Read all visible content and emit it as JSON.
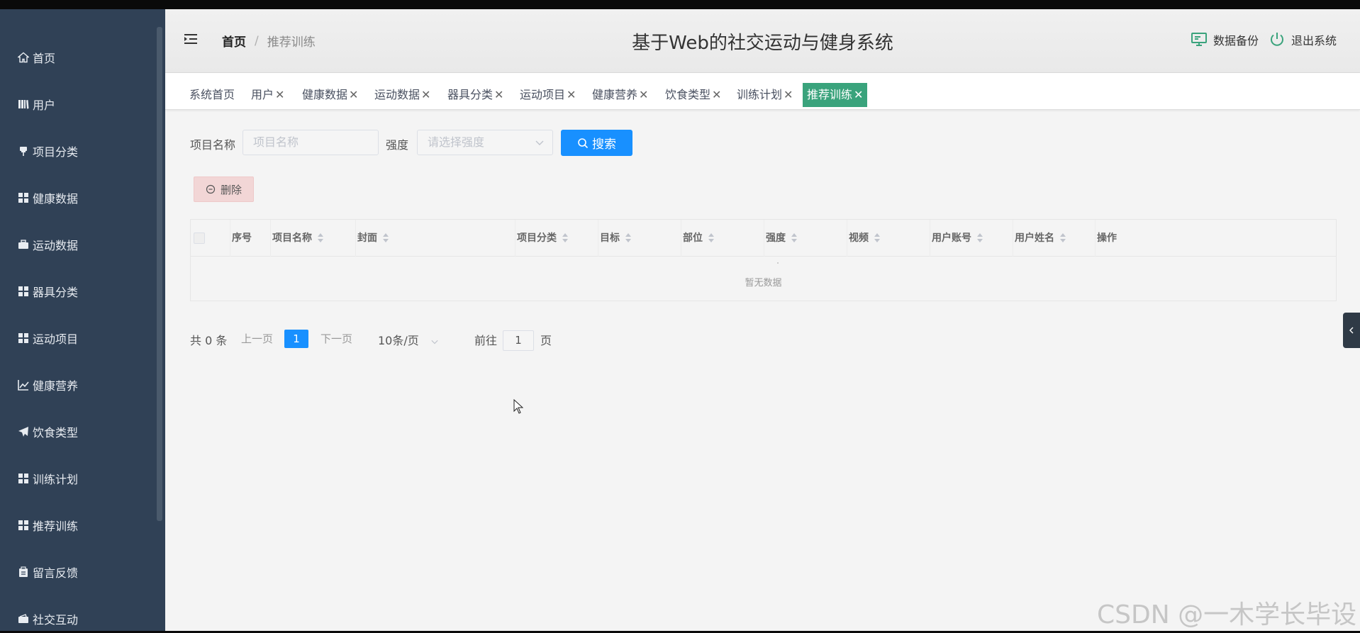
{
  "sidebar": {
    "items": [
      {
        "label": "首页",
        "icon": "home-icon"
      },
      {
        "label": "用户",
        "icon": "library-icon"
      },
      {
        "label": "项目分类",
        "icon": "pin-icon"
      },
      {
        "label": "健康数据",
        "icon": "grid-icon"
      },
      {
        "label": "运动数据",
        "icon": "briefcase-icon"
      },
      {
        "label": "器具分类",
        "icon": "grid-icon"
      },
      {
        "label": "运动项目",
        "icon": "grid-icon"
      },
      {
        "label": "健康营养",
        "icon": "chart-icon"
      },
      {
        "label": "饮食类型",
        "icon": "send-icon"
      },
      {
        "label": "训练计划",
        "icon": "grid-icon"
      },
      {
        "label": "推荐训练",
        "icon": "grid-icon"
      },
      {
        "label": "留言反馈",
        "icon": "clipboard-icon"
      },
      {
        "label": "社交互动",
        "icon": "wallet-icon"
      }
    ]
  },
  "header": {
    "breadcrumb_home": "首页",
    "breadcrumb_sep": "/",
    "breadcrumb_current": "推荐训练",
    "title": "基于Web的社交运动与健身系统",
    "backup_label": "数据备份",
    "logout_label": "退出系统"
  },
  "tabs": [
    {
      "label": "系统首页",
      "closable": false
    },
    {
      "label": "用户",
      "closable": true
    },
    {
      "label": "健康数据",
      "closable": true
    },
    {
      "label": "运动数据",
      "closable": true
    },
    {
      "label": "器具分类",
      "closable": true
    },
    {
      "label": "运动项目",
      "closable": true
    },
    {
      "label": "健康营养",
      "closable": true
    },
    {
      "label": "饮食类型",
      "closable": true
    },
    {
      "label": "训练计划",
      "closable": true
    },
    {
      "label": "推荐训练",
      "closable": true,
      "active": true
    }
  ],
  "tab_close_glyph": "✕",
  "search": {
    "name_label": "项目名称",
    "name_placeholder": "项目名称",
    "intensity_label": "强度",
    "intensity_placeholder": "请选择强度",
    "search_button": "搜索"
  },
  "actions": {
    "delete_button": "删除"
  },
  "table": {
    "columns": [
      {
        "label": "序号",
        "sortable": false
      },
      {
        "label": "项目名称",
        "sortable": true
      },
      {
        "label": "封面",
        "sortable": true
      },
      {
        "label": "项目分类",
        "sortable": true
      },
      {
        "label": "目标",
        "sortable": true
      },
      {
        "label": "部位",
        "sortable": true
      },
      {
        "label": "强度",
        "sortable": true
      },
      {
        "label": "视频",
        "sortable": true
      },
      {
        "label": "用户账号",
        "sortable": true
      },
      {
        "label": "用户姓名",
        "sortable": true
      },
      {
        "label": "操作",
        "sortable": false
      }
    ],
    "empty_text": "暂无数据"
  },
  "pagination": {
    "total": "共 0 条",
    "prev": "上一页",
    "current": "1",
    "next": "下一页",
    "page_size": "10条/页",
    "goto_label": "前往",
    "goto_value": "1",
    "goto_suffix": "页"
  },
  "watermark": "CSDN @一木学长毕设",
  "colors": {
    "sidebar_bg": "#304156",
    "active_tab": "#3aa37c",
    "primary": "#1890ff",
    "danger_light": "#f2d6d6"
  }
}
